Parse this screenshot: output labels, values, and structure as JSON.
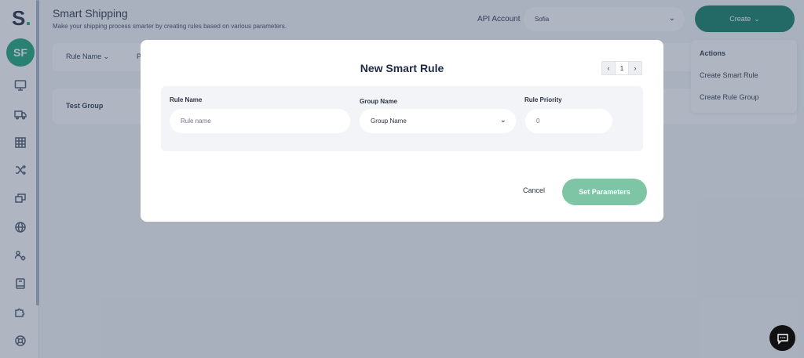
{
  "app": {
    "logo": "S",
    "avatar_initials": "SF",
    "page_title": "Smart Shipping",
    "page_subtitle": "Make your shipping process smarter by creating rules based on various parameters.",
    "api_account_label": "API Account",
    "api_account_value": "Sofia",
    "create_label": "Create",
    "filters": [
      {
        "label": "Rule Name"
      },
      {
        "label": "P"
      }
    ],
    "groups": [
      {
        "name": "Test Group"
      }
    ],
    "actions_menu": {
      "title": "Actions",
      "items": [
        {
          "label": "Create Smart Rule"
        },
        {
          "label": "Create Rule Group"
        }
      ]
    },
    "sidebar_icons": [
      "monitor-icon",
      "truck-icon",
      "grid-icon",
      "shuffle-icon",
      "packages-icon",
      "globe-icon",
      "people-gear-icon",
      "book-icon",
      "puzzle-icon",
      "lifebuoy-icon"
    ]
  },
  "modal": {
    "title": "New Smart Rule",
    "page": "1",
    "fields": {
      "rule_name": {
        "label": "Rule Name",
        "placeholder": "Rule name"
      },
      "group_name": {
        "label": "Group Name",
        "value": "Group Name"
      },
      "rule_priority": {
        "label": "Rule Priority",
        "value": "0"
      }
    },
    "cancel_label": "Cancel",
    "submit_label": "Set Parameters"
  },
  "colors": {
    "brand_green": "#0f7a61",
    "avatar_green": "#19a277",
    "submit_disabled": "#7ec5a6",
    "overlay": "rgba(64,80,110,0.42)"
  }
}
